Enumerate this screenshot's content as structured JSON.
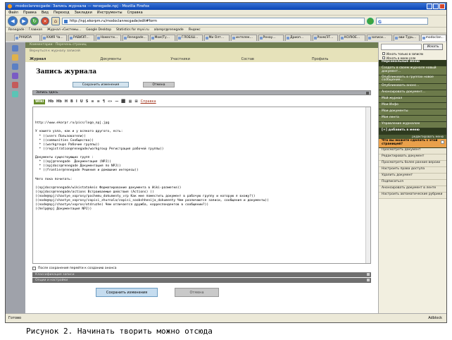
{
  "window": {
    "title": "modoclanreсgade: Запись журнала — renegade.npj - Mozilla Firefox"
  },
  "menu": [
    "Файл",
    "Правка",
    "Вид",
    "Переход",
    "Закладки",
    "Инструменты",
    "Справка"
  ],
  "address": {
    "url": "http://npj.ekorpm.ru/modoclanreсgade/edit#form"
  },
  "search_box": {
    "engine": "G",
    "value": ""
  },
  "bookmarks": [
    "Renegade :: Главная",
    "Журнал «Системы...",
    "Google Desktop",
    "Statistics for myvi.ru",
    "alarepr@renegade",
    "Яндекс"
  ],
  "tabs": [
    "РУКИЗА",
    "ХХИЯ Ча...",
    "РАВИЗП...",
    "Намести...",
    "Renegade...",
    "Мом(Ту...",
    "ГЛОБ/Ш...",
    "Ми Олт...",
    "интелек...",
    "Ренау...",
    "Дриоп...",
    "Рахм/ЗТ...",
    "КОЛЮЕ...",
    "записи...",
    "ави-Турь...",
    "modoclan..."
  ],
  "page": {
    "top_strip": "Комментарии · Перечень страниц",
    "breadcrumb": "Вернуться к журналу записей",
    "nav_tabs": [
      "Журнал",
      "Документы",
      "Участники",
      "Состав",
      "Профиль"
    ],
    "title": "Запись журнала",
    "save_top": "Сохранить изменения",
    "cancel_top": "Отмена",
    "section": "Запись здесь",
    "toolbar": {
      "wiki": "Wiki",
      "icons": [
        "Hb",
        "Hb",
        "H",
        "B",
        "I",
        "U",
        "S",
        "≡",
        "≡",
        "¶",
        "«»",
        "—",
        "⬛",
        "▦",
        "⊞"
      ],
      "help": "Справка"
    },
    "editor_lines": [
      "http://www.ekorpr.ru/pics/logo_npj.jpg",
      "",
      "У нашего узла, как и у всякого другого, есть:",
      "  * ((users Пользователи))",
      "  * ((communities Сообщества))",
      "  * ((workgroups Рабочие группы))",
      "  * ((registration@renegade/workgroup Регистрация рабочей группы))",
      "",
      "Документы существующих групп :",
      "  * ((npj@renegade  Документация (NPJ))",
      "  * ((npjdocs@renegade Документация по NPJ))",
      "  * ((frontier@renegade Решения и домашние интересы))",
      "",
      "Чего пока почитать:",
      "",
      "((npjdocs@renegade/wikistatakeis Форматирование документа в Wiki-разметке))",
      "((npjdocs@renegade/actions Встраиваемые действия (Actions) ))",
      "((node@npj/chastye_voprosy/pochemu_dokumenty_vrp Как мне поместить документ в рабочую группу и которую я вхожу?))",
      "((node@npj/chastye_voprosy/zapisi_zhurnala/zapisi_soobshhenija_dokumenty Чем различаются записи, сообщения и документы))",
      "((node@npj/chastye/vopros/otdruzhe) Чем отличается дружба, корреспондентов в сообщении?))",
      "((help@npj Документация NPJ))"
    ],
    "after_save_label": "После сохранения перейти к созданию анонса",
    "group_bar_1": "Классификация записи",
    "group_bar_2": "Опции и настройки",
    "save_bottom": "Сохранить изменения",
    "cancel_bottom": "Отмена"
  },
  "sidebar": {
    "find_button": "Искать",
    "checks": [
      "Искать только в записях",
      "Искать в моем узле"
    ],
    "items": [
      {
        "label": "Персональные меню",
        "style": "dark"
      },
      {
        "label": "Создать в своем журнале новый документ...",
        "style": "olive"
      },
      {
        "label": "Опубликовать в группах новое сообщение...",
        "style": "olive"
      },
      {
        "label": "Опубликовать анонс...",
        "style": "olive"
      },
      {
        "label": "Анонсировать документ...",
        "style": "olive"
      },
      {
        "label": "Мой журнал",
        "style": "olive"
      },
      {
        "label": "Мои Инфо",
        "style": "olive"
      },
      {
        "label": "Мои документы",
        "style": "olive"
      },
      {
        "label": "Моя лента",
        "style": "olive"
      },
      {
        "label": "Управление журналом",
        "style": "olive"
      },
      {
        "label": "[+] добавить в меню",
        "style": "dark"
      }
    ],
    "note": "редактировать меню",
    "promo": "Что вы можете сделать с этой страницей?",
    "actions": [
      "Просмотреть документ",
      "Редактировать документ",
      "Просмотреть более ранние версии",
      "Настроить права доступа",
      "Удалить документ",
      "Подписаться",
      "Анонсировать документ в ленте",
      "Настроить автоматические рубрики"
    ]
  },
  "statusbar": {
    "left": "Готово",
    "right": "Adblock"
  },
  "caption": "Рисунок 2. Начинать творить можно отсюда",
  "colors": {
    "accent_olive": "#4a5a33",
    "promo_orange": "#e9a04b",
    "titlebar_blue": "#0b45b5"
  }
}
